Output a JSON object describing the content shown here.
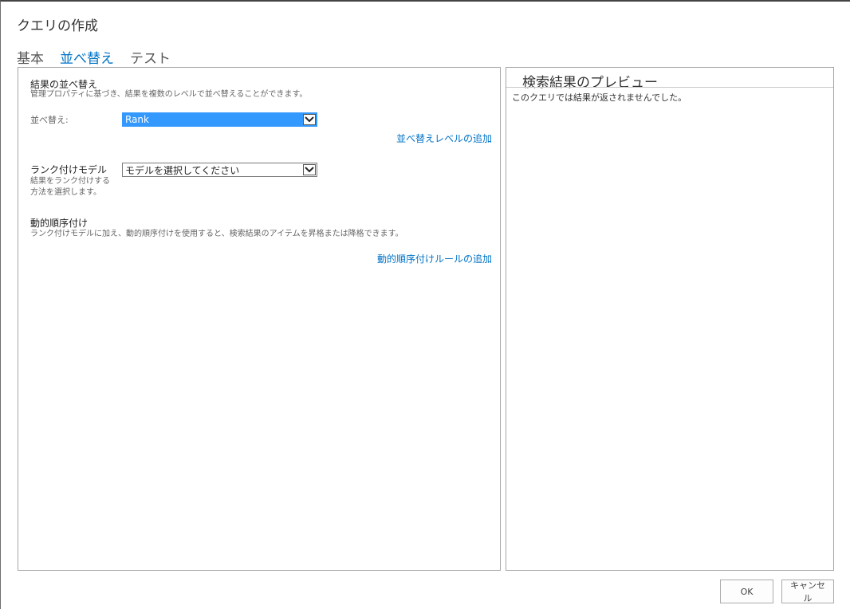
{
  "dialog": {
    "title": "クエリの作成"
  },
  "tabs": [
    {
      "label": "基本",
      "active": false
    },
    {
      "label": "並べ替え",
      "active": true
    },
    {
      "label": "テスト",
      "active": false
    }
  ],
  "sort_panel": {
    "sort_results": {
      "title": "結果の並べ替え",
      "description": "管理プロパティに基づき、結果を複数のレベルで並べ替えることができます。"
    },
    "sort_by": {
      "label": "並べ替え:",
      "selected_value": "Rank"
    },
    "add_sort_level_link": "並べ替えレベルの追加",
    "ranking_model": {
      "title": "ランク付けモデル",
      "description_line1": "結果をランク付けする",
      "description_line2": "方法を選択します。",
      "selected_value": "モデルを選択してください"
    },
    "dynamic_ordering": {
      "title": "動的順序付け",
      "description": "ランク付けモデルに加え、動的順序付けを使用すると、検索結果のアイテムを昇格または降格できます。"
    },
    "add_dynamic_rule_link": "動的順序付けルールの追加"
  },
  "preview": {
    "title": "検索結果のプレビュー",
    "message": "このクエリでは結果が返されませんでした。"
  },
  "buttons": {
    "ok": "OK",
    "cancel": "キャンセル"
  },
  "colors": {
    "accent": "#0072c6",
    "selection": "#3399ff",
    "border": "#a6a6a6"
  },
  "icons": {
    "dropdown": "chevron-down-icon"
  }
}
